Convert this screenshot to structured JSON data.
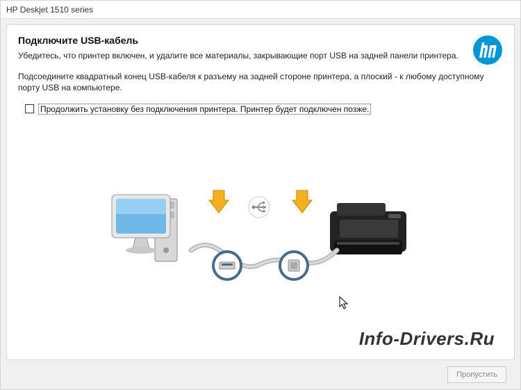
{
  "window": {
    "title": "HP Deskjet 1510 series"
  },
  "header": {
    "heading": "Подключите USB-кабель",
    "subheading": "Убедитесь, что принтер включен, и удалите все материалы, закрывающие порт USB на задней панели принтера."
  },
  "instruction": "Подсоедините квадратный конец USB-кабеля к разъему на задней стороне принтера, а плоский - к любому доступному порту USB на компьютере.",
  "checkbox": {
    "checked": false,
    "label": "Продолжить установку без подключения принтера. Принтер будет подключен позже."
  },
  "footer": {
    "skip_label": "Пропустить"
  },
  "watermark": "Info-Drivers.Ru",
  "colors": {
    "hp_blue": "#0096D6",
    "arrow_yellow": "#F5B020",
    "monitor_blue": "#6FB8E8",
    "printer_dark": "#222222"
  },
  "icons": {
    "hp_logo": "hp-logo",
    "computer": "computer-icon",
    "printer": "printer-icon",
    "usb_symbol": "usb-icon",
    "arrow_down": "arrow-down-icon",
    "usb_plug": "usb-plug-icon"
  }
}
